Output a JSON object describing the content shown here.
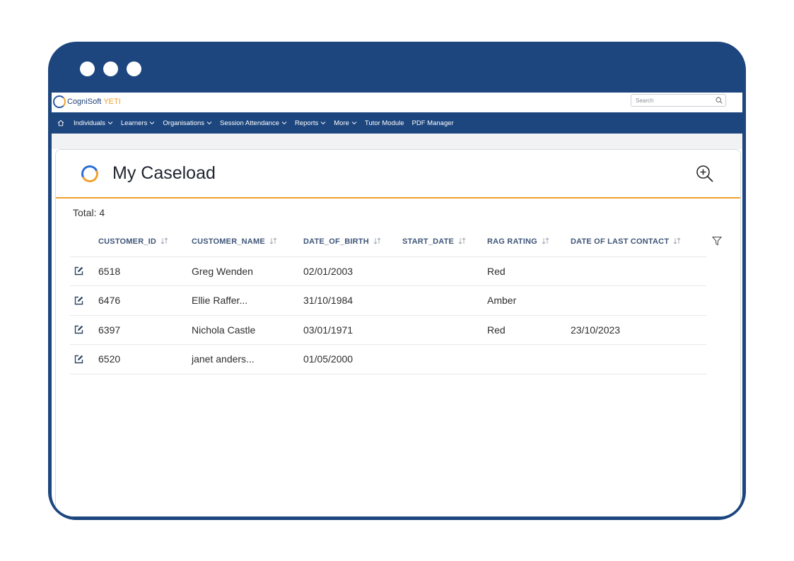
{
  "brand": {
    "name_a": "CogniSoft",
    "name_b": "YETI"
  },
  "search": {
    "placeholder": "Search"
  },
  "nav": [
    {
      "label": "Individuals",
      "dropdown": true
    },
    {
      "label": "Learners",
      "dropdown": true
    },
    {
      "label": "Organisations",
      "dropdown": true
    },
    {
      "label": "Session Attendance",
      "dropdown": true
    },
    {
      "label": "Reports",
      "dropdown": true
    },
    {
      "label": "More",
      "dropdown": true
    },
    {
      "label": "Tutor Module",
      "dropdown": false
    },
    {
      "label": "PDF Manager",
      "dropdown": false
    }
  ],
  "page": {
    "title": "My Caseload",
    "total": "Total: 4"
  },
  "table": {
    "columns": [
      "CUSTOMER_ID",
      "CUSTOMER_NAME",
      "DATE_OF_BIRTH",
      "START_DATE",
      "RAG RATING",
      "DATE OF LAST CONTACT"
    ],
    "rows": [
      [
        "6518",
        "Greg Wenden",
        "02/01/2003",
        "",
        "Red",
        ""
      ],
      [
        "6476",
        "Ellie Raffer...",
        "31/10/1984",
        "",
        "Amber",
        ""
      ],
      [
        "6397",
        "Nichola Castle",
        "03/01/1971",
        "",
        "Red",
        "23/10/2023"
      ],
      [
        "6520",
        "janet anders...",
        "01/05/2000",
        "",
        "",
        ""
      ]
    ]
  },
  "colors": {
    "frame": "#1d467f",
    "accent": "#f0a02c",
    "header_text": "#3f5678"
  },
  "icons": [
    "home-icon",
    "chevron-down-icon",
    "search-icon",
    "zoom-in-icon",
    "sort-icon",
    "filter-icon",
    "edit-icon"
  ]
}
